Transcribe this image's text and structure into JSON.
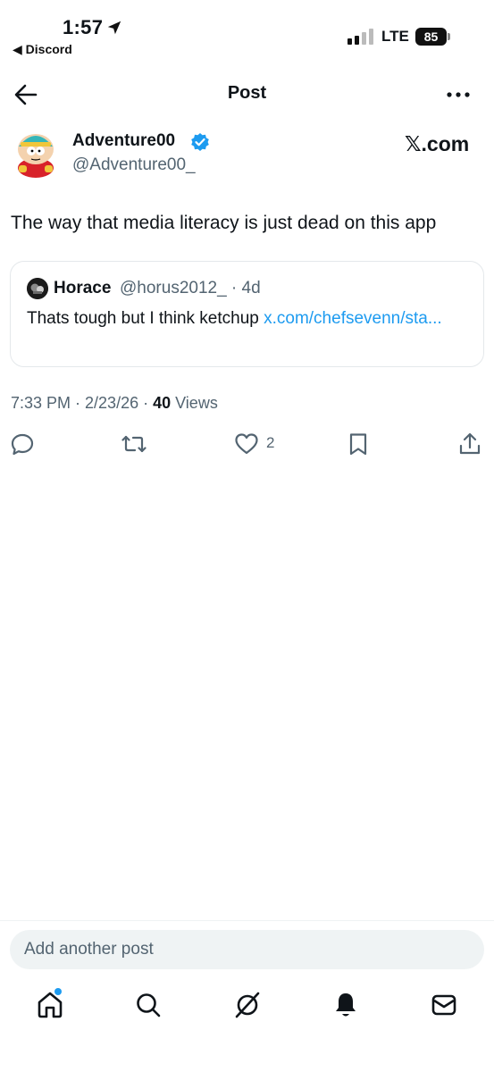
{
  "status_bar": {
    "time": "1:57",
    "back_app": "◀ Discord",
    "network": "LTE",
    "battery": "85"
  },
  "header": {
    "title": "Post"
  },
  "post": {
    "display_name": "Adventure00",
    "handle": "@Adventure00_",
    "source": "𝕏.com",
    "text": "The way that media literacy is just dead on this app",
    "quote": {
      "name": "Horace",
      "handle_time": "@horus2012_ · 4d",
      "text": "Thats tough but I think ketchup ",
      "link": "x.com/chefsevenn/sta..."
    },
    "meta": {
      "time_date": "7:33 PM · 2/23/26 · ",
      "views_count": "40",
      "views_label": " Views"
    },
    "actions": {
      "like_count": "2"
    }
  },
  "composer": {
    "placeholder": "Add another post"
  },
  "nav": {
    "items": [
      "home-icon",
      "search-icon",
      "grok-icon",
      "notifications-icon",
      "messages-icon"
    ]
  },
  "colors": {
    "accent": "#1d9bf0",
    "secondary_text": "#536471"
  }
}
